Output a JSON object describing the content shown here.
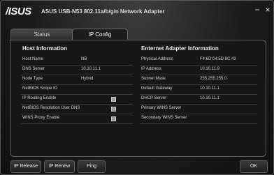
{
  "window": {
    "logo": "/ISUS",
    "title": "ASUS USB-N53 802.11a/b/g/n Network Adapter",
    "minimize_glyph": "−",
    "close_glyph": "×"
  },
  "tabs": [
    {
      "label": "Status",
      "active": false
    },
    {
      "label": "IP Config",
      "active": true
    }
  ],
  "host_info": {
    "heading": "Host Information",
    "rows": [
      {
        "label": "Host Name",
        "value": "NB"
      },
      {
        "label": "DNS Server",
        "value": "10.10.11.1"
      },
      {
        "label": "Node Type",
        "value": "Hybrid"
      },
      {
        "label": "NetBIOS Scope ID",
        "value": ""
      },
      {
        "label": "IP Routing Enable",
        "checkbox": true
      },
      {
        "label": "NetBIOS Resolution User DNS",
        "checkbox": true
      },
      {
        "label": "WINS Proxy Enable",
        "checkbox": true
      }
    ]
  },
  "ethernet_info": {
    "heading": "Enternet Adapter Information",
    "rows": [
      {
        "label": "Physical Address",
        "value": "F4:6D:04:5D:9C:43"
      },
      {
        "label": "IP Address",
        "value": "10.10.11.9"
      },
      {
        "label": "Subnet Mask",
        "value": "255.255.255.0"
      },
      {
        "label": "Default Gateway",
        "value": "10.10.11.1"
      },
      {
        "label": "DHCP Server",
        "value": "10.10.11.1"
      },
      {
        "label": "Primary WINS Server",
        "value": ""
      },
      {
        "label": "Secondary WINS Server",
        "value": ""
      }
    ]
  },
  "buttons": {
    "ip_release": "IP Release",
    "ip_renew": "IP Renew",
    "ping": "Ping",
    "ok": "OK"
  }
}
